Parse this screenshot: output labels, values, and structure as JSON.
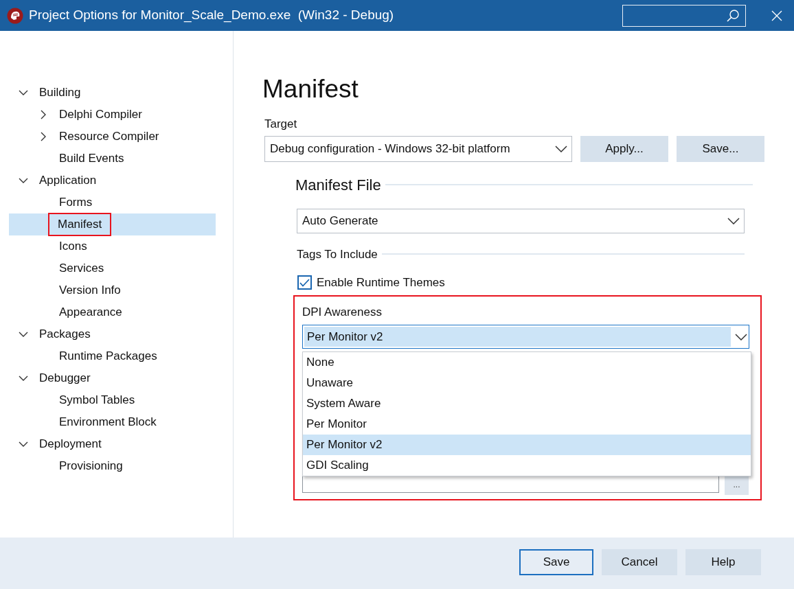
{
  "window": {
    "title": "Project Options for Monitor_Scale_Demo.exe  (Win32 - Debug)"
  },
  "tree": [
    {
      "label": "Building",
      "expanded": true,
      "selected": false,
      "annotated": false,
      "children": [
        {
          "label": "Delphi Compiler",
          "expanded": false,
          "selected": false,
          "annotated": false
        },
        {
          "label": "Resource Compiler",
          "expanded": false,
          "selected": false,
          "annotated": false
        },
        {
          "label": "Build Events",
          "selected": false,
          "annotated": false
        }
      ]
    },
    {
      "label": "Application",
      "expanded": true,
      "selected": false,
      "annotated": false,
      "children": [
        {
          "label": "Forms",
          "selected": false,
          "annotated": false
        },
        {
          "label": "Manifest",
          "selected": true,
          "annotated": true
        },
        {
          "label": "Icons",
          "selected": false,
          "annotated": false
        },
        {
          "label": "Services",
          "selected": false,
          "annotated": false
        },
        {
          "label": "Version Info",
          "selected": false,
          "annotated": false
        },
        {
          "label": "Appearance",
          "selected": false,
          "annotated": false
        }
      ]
    },
    {
      "label": "Packages",
      "expanded": true,
      "selected": false,
      "annotated": false,
      "children": [
        {
          "label": "Runtime Packages",
          "selected": false,
          "annotated": false
        }
      ]
    },
    {
      "label": "Debugger",
      "expanded": true,
      "selected": false,
      "annotated": false,
      "children": [
        {
          "label": "Symbol Tables",
          "selected": false,
          "annotated": false
        },
        {
          "label": "Environment Block",
          "selected": false,
          "annotated": false
        }
      ]
    },
    {
      "label": "Deployment",
      "expanded": true,
      "selected": false,
      "annotated": false,
      "children": [
        {
          "label": "Provisioning",
          "selected": false,
          "annotated": false
        }
      ]
    }
  ],
  "page": {
    "title": "Manifest",
    "target": {
      "label": "Target",
      "value": "Debug configuration - Windows 32-bit platform"
    },
    "buttons": [
      "Apply...",
      "Save..."
    ],
    "manifest_file": {
      "title": "Manifest File",
      "mode": "Auto Generate"
    },
    "tags": {
      "title": "Tags To Include",
      "option": {
        "label": "Enable Runtime Themes",
        "checked": true
      }
    },
    "dpi": {
      "label": "DPI Awareness",
      "value": "Per Monitor v2",
      "annotated": true,
      "expanded": true,
      "options": [
        {
          "label": "None",
          "selected": false
        },
        {
          "label": "Unaware",
          "selected": false
        },
        {
          "label": "System Aware",
          "selected": false
        },
        {
          "label": "Per Monitor",
          "selected": false
        },
        {
          "label": "Per Monitor v2",
          "selected": true
        },
        {
          "label": "GDI Scaling",
          "selected": false
        }
      ]
    },
    "browse_button": "..."
  },
  "footer": {
    "buttons": [
      {
        "label": "Save",
        "default": true
      },
      {
        "label": "Cancel",
        "default": false
      },
      {
        "label": "Help",
        "default": false
      }
    ]
  }
}
